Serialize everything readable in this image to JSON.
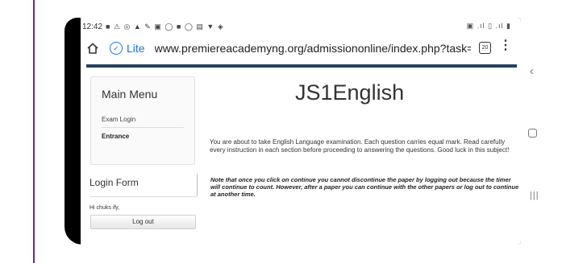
{
  "status_bar": {
    "time": "12:42",
    "icons": "■ ⚠ ◎ ▲ ✎ ▣ ◯ ■ ◯ ▤ ▼ ◈",
    "right_icons": "▣ .ıl ▯ .ıl ▮"
  },
  "browser": {
    "lite_label": "Lite",
    "url": "www.premiereacademyng.org/admissiononline/index.php?task=quiz&qu",
    "tabs_count": "20",
    "icons": {
      "home": "home-icon",
      "lite": "lite-mode-icon",
      "menu": "more-vert-icon"
    }
  },
  "sidebar": {
    "main_menu_title": "Main Menu",
    "items": [
      "Exam Login",
      "Entrance"
    ],
    "login_form_title": "Login Form",
    "greeting": "Hi chuks ify,",
    "logout_label": "Log out"
  },
  "main": {
    "title": "JS1English",
    "instructions": "You are about to take English Language examination. Each question carries equal mark. Read carefully every instruction in each section before proceeding to answering the questions. Good luck in this subject!",
    "note": "Note that once you click on continue you cannot discontinue the paper by logging out because the timer will continue to count. However, after a paper you can continue with the other papers or log out to continue at another time."
  },
  "nav_bar": {
    "back_icon": "back-chevron-icon",
    "home_icon": "home-square-icon",
    "recents_icon": "recents-icon",
    "back_glyph": "‹",
    "recents_glyph": "|||"
  }
}
